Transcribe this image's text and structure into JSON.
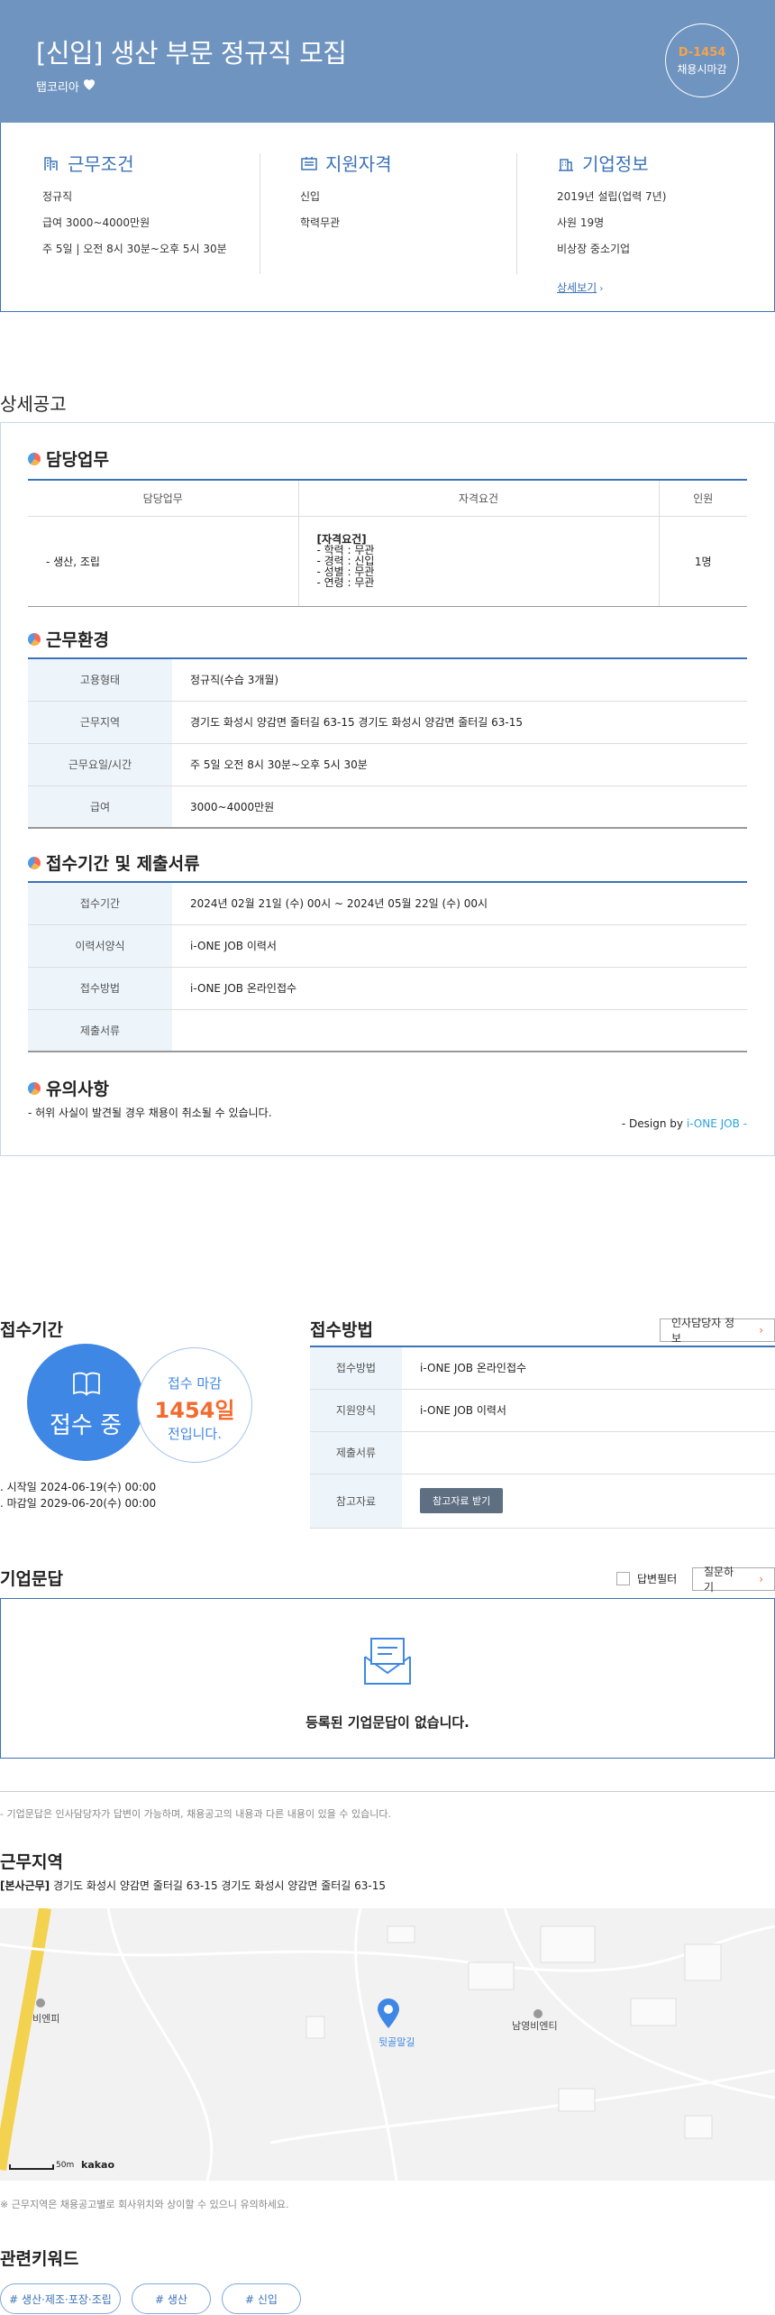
{
  "header": {
    "title": "[신입] 생산 부문 정규직 모집",
    "company": "탭코리아",
    "dday": "D-1454",
    "dday_label": "채용시마감"
  },
  "summary": {
    "work": {
      "title": "근무조건",
      "lines": [
        "정규직",
        "급여 3000~4000만원",
        "주 5일 | 오전 8시 30분~오후 5시 30분"
      ]
    },
    "qual": {
      "title": "지원자격",
      "lines": [
        "신입",
        "학력무관"
      ]
    },
    "company": {
      "title": "기업정보",
      "lines": [
        "2019년 설립(업력 7년)",
        "사원 19명",
        "비상장 중소기업"
      ],
      "link": "상세보기"
    }
  },
  "detail": {
    "heading": "상세공고",
    "duty": {
      "title": "담당업무",
      "headers": [
        "담당업무",
        "자격요건",
        "인원"
      ],
      "row": {
        "duty": "- 생산, 조립",
        "req_title": "[자격요건]",
        "req": [
          "- 학력 : 무관",
          "- 경력 : 신입",
          "- 성별 : 무관",
          "- 연령 : 무관"
        ],
        "count": "1명"
      }
    },
    "env": {
      "title": "근무환경",
      "rows": [
        {
          "k": "고용형태",
          "v": "정규직(수습 3개월)"
        },
        {
          "k": "근무지역",
          "v": "경기도 화성시 양감면 줄터길 63-15 경기도 화성시 양감면 줄터길 63-15"
        },
        {
          "k": "근무요일/시간",
          "v": "주 5일 오전 8시 30분~오후 5시 30분"
        },
        {
          "k": "급여",
          "v": "3000~4000만원"
        }
      ]
    },
    "apply": {
      "title": "접수기간 및 제출서류",
      "rows": [
        {
          "k": "접수기간",
          "v": "2024년 02월 21일 (수) 00시 ~ 2024년 05월 22일 (수) 00시"
        },
        {
          "k": "이력서양식",
          "v": "i-ONE JOB 이력서"
        },
        {
          "k": "접수방법",
          "v": "i-ONE JOB 온라인접수"
        },
        {
          "k": "제출서류",
          "v": ""
        }
      ]
    },
    "notice": {
      "title": "유의사항",
      "text": "- 허위 사실이 발견될 경우 채용이 취소될 수 있습니다.",
      "design_prefix": "- Design by ",
      "design_brand": "i-ONE JOB -"
    }
  },
  "period": {
    "title": "접수기간",
    "status": "접수 중",
    "deadline_label": "접수 마감",
    "days": "1454일",
    "days_suffix": "전입니다.",
    "start": "시작일 2024-06-19(수) 00:00",
    "end": "마감일 2029-06-20(수) 00:00"
  },
  "method": {
    "title": "접수방법",
    "contact_button": "인사담당자 정보",
    "rows": [
      {
        "k": "접수방법",
        "v": "i-ONE JOB 온라인접수"
      },
      {
        "k": "지원양식",
        "v": "i-ONE JOB 이력서"
      },
      {
        "k": "제출서류",
        "v": ""
      },
      {
        "k": "참고자료",
        "button": "참고자료 받기"
      }
    ]
  },
  "qna": {
    "title": "기업문답",
    "checkbox": "답변필터",
    "ask_button": "질문하기",
    "empty": "등록된 기업문답이 없습니다.",
    "note": "- 기업문답은 인사담당자가 답변이 가능하며, 채용공고의 내용과 다른 내용이 있을 수 있습니다."
  },
  "location": {
    "title": "근무지역",
    "tag": "[본사근무]",
    "address": "경기도 화성시 양감면 줄터길 63-15 경기도 화성시 양감면 줄터길 63-15",
    "map": {
      "place1": "비엔피",
      "place2": "남영비엔티",
      "marker": "뒷골말길",
      "scale": "50m",
      "provider": "kakao"
    },
    "note": "※ 근무지역은 채용공고별로 회사위치와 상이할 수 있으니 유의하세요."
  },
  "keywords": {
    "title": "관련키워드",
    "items": [
      "# 생산·제조·포장·조립",
      "# 생산",
      "# 신입"
    ]
  },
  "colors": {
    "primary": "#3b73b8",
    "header_bg": "#6f94c0",
    "accent": "#f36a2e",
    "dday": "#f5a44a"
  }
}
